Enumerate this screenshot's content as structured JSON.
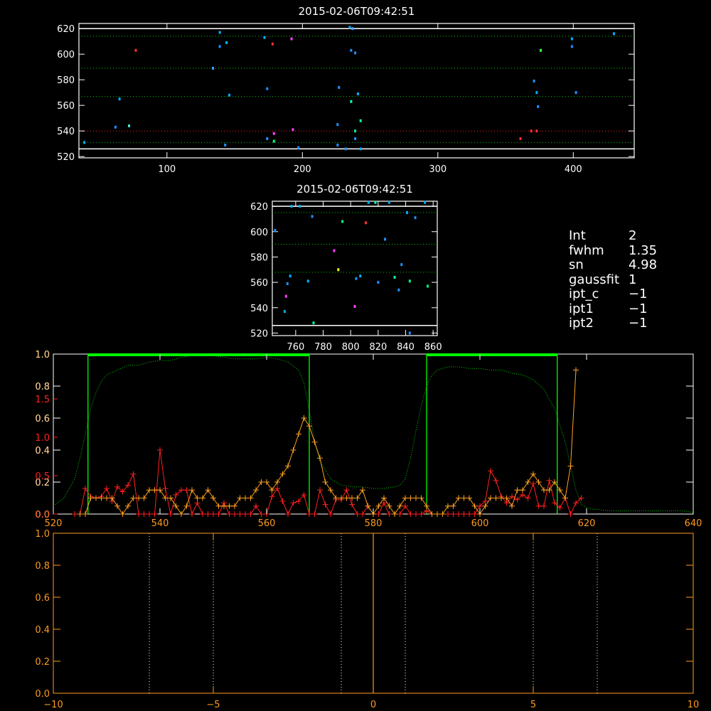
{
  "colors": {
    "background": "#000000",
    "axis": "#ffffff",
    "orange_axis": "#ff9a1e",
    "red": "#ff2020",
    "orange": "#ffa020",
    "green": "#00ff00",
    "cyan_dots": "#00b0ff"
  },
  "chart_data": [
    {
      "id": "top",
      "type": "scatter",
      "title": "2015-02-06T09:42:51",
      "xlim": [
        35,
        445
      ],
      "ylim": [
        519,
        624
      ],
      "xticks": [
        100,
        200,
        300,
        400
      ],
      "yticks": [
        520,
        540,
        560,
        580,
        600,
        620
      ],
      "hlines": [
        {
          "y": 620,
          "color": "#ffffff",
          "style": "solid"
        },
        {
          "y": 614,
          "color": "#00cc00",
          "style": "dotted"
        },
        {
          "y": 589,
          "color": "#00cc00",
          "style": "dotted"
        },
        {
          "y": 567,
          "color": "#00cc00",
          "style": "dotted"
        },
        {
          "y": 540,
          "color": "#ff2020",
          "style": "dotted"
        },
        {
          "y": 531,
          "color": "#00cc00",
          "style": "dotted"
        },
        {
          "y": 526,
          "color": "#ffffff",
          "style": "solid"
        }
      ],
      "points": [
        [
          39,
          531,
          "#00b0ff"
        ],
        [
          62,
          543,
          "#1e90ff"
        ],
        [
          65,
          565,
          "#00b0ff"
        ],
        [
          72,
          544,
          "#40e0d0"
        ],
        [
          77,
          603,
          "#ff3030"
        ],
        [
          134,
          589,
          "#40a0ff"
        ],
        [
          139,
          617,
          "#00b0ff"
        ],
        [
          139,
          606,
          "#1e90ff"
        ],
        [
          143,
          529,
          "#1e90ff"
        ],
        [
          144,
          609,
          "#00b0ff"
        ],
        [
          146,
          568,
          "#00b0ff"
        ],
        [
          172,
          613,
          "#00b0ff"
        ],
        [
          174,
          534,
          "#1e90ff"
        ],
        [
          174,
          573,
          "#1e90ff"
        ],
        [
          178,
          608,
          "#ff3030"
        ],
        [
          179,
          538,
          "#ff40ff"
        ],
        [
          179,
          532,
          "#00ff80"
        ],
        [
          192,
          612,
          "#ff40ff"
        ],
        [
          193,
          541,
          "#ff40ff"
        ],
        [
          197,
          527,
          "#1e90ff"
        ],
        [
          226,
          545,
          "#1e90ff"
        ],
        [
          226,
          529,
          "#1e90ff"
        ],
        [
          227,
          574,
          "#1e90ff"
        ],
        [
          232,
          526,
          "#1e90ff"
        ],
        [
          235,
          621,
          "#00b0ff"
        ],
        [
          237,
          620,
          "#40a0ff"
        ],
        [
          236,
          603,
          "#1e90ff"
        ],
        [
          236,
          563,
          "#00ffb0"
        ],
        [
          239,
          601,
          "#1e90ff"
        ],
        [
          239,
          540,
          "#00ffb0"
        ],
        [
          239,
          534,
          "#1e90ff"
        ],
        [
          241,
          569,
          "#00b0ff"
        ],
        [
          243,
          548,
          "#00ffb0"
        ],
        [
          243,
          526,
          "#00b0ff"
        ],
        [
          361,
          534,
          "#ff3030"
        ],
        [
          369,
          540,
          "#ff3030"
        ],
        [
          371,
          579,
          "#1e90ff"
        ],
        [
          373,
          540,
          "#ff3030"
        ],
        [
          373,
          570,
          "#00b0ff"
        ],
        [
          374,
          559,
          "#1e90ff"
        ],
        [
          376,
          603,
          "#40ff40"
        ],
        [
          399,
          606,
          "#1e90ff"
        ],
        [
          399,
          612,
          "#00b0ff"
        ],
        [
          402,
          570,
          "#1e90ff"
        ],
        [
          430,
          616,
          "#00b0ff"
        ]
      ]
    },
    {
      "id": "middle",
      "type": "scatter",
      "title": "2015-02-06T09:42:51",
      "xlim": [
        743,
        863
      ],
      "ylim": [
        518,
        624
      ],
      "xticks": [
        760,
        780,
        800,
        820,
        840,
        860
      ],
      "yticks": [
        520,
        540,
        560,
        580,
        600,
        620
      ],
      "hlines": [
        {
          "y": 620,
          "color": "#ffffff",
          "style": "solid"
        },
        {
          "y": 615,
          "color": "#00cc00",
          "style": "dotted"
        },
        {
          "y": 590,
          "color": "#00cc00",
          "style": "dotted"
        },
        {
          "y": 568,
          "color": "#00cc00",
          "style": "dotted"
        },
        {
          "y": 526,
          "color": "#ffffff",
          "style": "solid"
        }
      ],
      "points": [
        [
          745,
          601,
          "#1e90ff"
        ],
        [
          752,
          537,
          "#00b0ff"
        ],
        [
          753,
          549,
          "#ff40ff"
        ],
        [
          754,
          559,
          "#1e90ff"
        ],
        [
          756,
          565,
          "#00b0ff"
        ],
        [
          757,
          620,
          "#00b0ff"
        ],
        [
          763,
          620,
          "#00b0ff"
        ],
        [
          769,
          561,
          "#00b0ff"
        ],
        [
          772,
          612,
          "#1e90ff"
        ],
        [
          773,
          528,
          "#00ffb0"
        ],
        [
          788,
          585,
          "#ff40ff"
        ],
        [
          791,
          570,
          "#ffff00"
        ],
        [
          794,
          608,
          "#00ff80"
        ],
        [
          803,
          541,
          "#ff40ff"
        ],
        [
          804,
          563,
          "#1e90ff"
        ],
        [
          807,
          565,
          "#00b0ff"
        ],
        [
          811,
          607,
          "#ff3030"
        ],
        [
          813,
          623,
          "#00b0ff"
        ],
        [
          818,
          623,
          "#00ffb0"
        ],
        [
          820,
          560,
          "#1e90ff"
        ],
        [
          825,
          594,
          "#1e90ff"
        ],
        [
          828,
          623,
          "#00b0ff"
        ],
        [
          832,
          564,
          "#00ffb0"
        ],
        [
          835,
          554,
          "#1e90ff"
        ],
        [
          837,
          574,
          "#1e90ff"
        ],
        [
          841,
          615,
          "#00b0ff"
        ],
        [
          843,
          561,
          "#00ff80"
        ],
        [
          843,
          520,
          "#1e90ff"
        ],
        [
          847,
          611,
          "#1e90ff"
        ],
        [
          854,
          623,
          "#00b0ff"
        ],
        [
          856,
          557,
          "#00ff80"
        ]
      ]
    },
    {
      "id": "spectrum",
      "type": "line",
      "xlim": [
        520,
        640
      ],
      "ylim": [
        0,
        1.0
      ],
      "xticks": [
        520,
        540,
        560,
        580,
        600,
        620,
        640
      ],
      "yticks_white": [
        "0.0",
        "0.2",
        "0.4",
        "0.6",
        "0.8",
        "1.0"
      ],
      "yticks_red": [
        "0.0",
        "0.5",
        "1.0",
        "1.5"
      ],
      "yticks_red_values": [
        0,
        0.24,
        0.48,
        0.72
      ],
      "yticks_orange": [
        "0.0",
        "0.2",
        "0.4",
        "0.6",
        "0.8",
        "1.0"
      ],
      "green_boxes": [
        [
          526.5,
          568
        ],
        [
          590,
          614.5
        ]
      ],
      "series": [
        {
          "color": "#00cc00",
          "style": "dotted",
          "x": [
            520,
            522,
            524,
            525,
            526,
            527,
            528,
            529,
            530,
            532,
            534,
            536,
            538,
            540,
            542,
            544,
            546,
            548,
            550,
            552,
            554,
            556,
            558,
            560,
            562,
            564,
            566,
            567,
            568,
            569,
            570,
            572,
            574,
            576,
            578,
            580,
            582,
            584,
            585,
            586,
            587,
            588,
            589,
            590,
            591,
            592,
            594,
            596,
            598,
            600,
            602,
            604,
            606,
            608,
            610,
            612,
            614,
            616,
            617,
            618,
            619,
            620,
            621,
            622,
            624,
            626,
            628,
            630,
            632,
            634,
            636,
            638,
            640
          ],
          "y": [
            0.05,
            0.1,
            0.22,
            0.35,
            0.5,
            0.66,
            0.76,
            0.83,
            0.87,
            0.9,
            0.93,
            0.93,
            0.95,
            0.96,
            0.96,
            0.98,
            0.99,
            1.0,
            0.99,
            0.98,
            0.97,
            0.97,
            0.97,
            0.98,
            0.97,
            0.95,
            0.9,
            0.82,
            0.65,
            0.45,
            0.33,
            0.22,
            0.18,
            0.17,
            0.17,
            0.16,
            0.16,
            0.17,
            0.18,
            0.22,
            0.35,
            0.52,
            0.68,
            0.8,
            0.87,
            0.9,
            0.92,
            0.92,
            0.91,
            0.91,
            0.9,
            0.9,
            0.88,
            0.87,
            0.84,
            0.78,
            0.66,
            0.45,
            0.3,
            0.15,
            0.06,
            0.04,
            0.03,
            0.03,
            0.02,
            0.02,
            0.02,
            0.02,
            0.02,
            0.02,
            0.02,
            0.02,
            0.01
          ]
        },
        {
          "color": "#ff2020",
          "style": "solid",
          "marker": "plus",
          "x": [
            524,
            525,
            526,
            527,
            528,
            529,
            530,
            531,
            532,
            533,
            534,
            535,
            536,
            537,
            538,
            539,
            540,
            541,
            542,
            543,
            544,
            545,
            546,
            547,
            548,
            549,
            550,
            551,
            552,
            553,
            554,
            555,
            556,
            557,
            558,
            559,
            560,
            561,
            562,
            563,
            564,
            565,
            566,
            567,
            568,
            569,
            570,
            571,
            572,
            573,
            574,
            575,
            576,
            577,
            578,
            579,
            580,
            581,
            582,
            583,
            584,
            585,
            586,
            587,
            588,
            589,
            590,
            591,
            592,
            593,
            594,
            595,
            596,
            597,
            598,
            599,
            600,
            601,
            602,
            603,
            604,
            605,
            606,
            607,
            608,
            609,
            610,
            611,
            612,
            613,
            614,
            615,
            616,
            617,
            618,
            619
          ],
          "y": [
            0,
            0,
            0.16,
            0.11,
            0.1,
            0.11,
            0.16,
            0.08,
            0.17,
            0.14,
            0.18,
            0.25,
            0,
            0,
            0,
            0,
            0.4,
            0.16,
            0,
            0.12,
            0.15,
            0.15,
            0,
            0.07,
            0,
            0,
            0,
            0,
            0.07,
            0,
            0,
            0,
            0,
            0,
            0.05,
            0,
            0,
            0.11,
            0.16,
            0.08,
            0,
            0.07,
            0.08,
            0.12,
            0,
            0,
            0.15,
            0.06,
            0,
            0.09,
            0.09,
            0.15,
            0.06,
            0,
            0,
            0.05,
            0,
            0,
            0.07,
            0,
            0,
            0,
            0.05,
            0,
            0,
            0,
            0.02,
            0,
            0,
            0,
            0,
            0,
            0,
            0,
            0,
            0,
            0.05,
            0.08,
            0.27,
            0.21,
            0.11,
            0.07,
            0.11,
            0.09,
            0.12,
            0.1,
            0.19,
            0.05,
            0.05,
            0.21,
            0.07,
            0.04,
            0.1,
            0,
            0.07,
            0.1
          ]
        },
        {
          "color": "#ffa020",
          "style": "solid",
          "marker": "plus",
          "x": [
            525,
            526,
            527,
            528,
            529,
            530,
            531,
            532,
            533,
            534,
            535,
            536,
            537,
            538,
            539,
            540,
            541,
            542,
            543,
            544,
            545,
            546,
            547,
            548,
            549,
            550,
            551,
            552,
            553,
            554,
            555,
            556,
            557,
            558,
            559,
            560,
            561,
            562,
            563,
            564,
            565,
            566,
            567,
            568,
            569,
            570,
            571,
            572,
            573,
            574,
            575,
            576,
            577,
            578,
            579,
            580,
            581,
            582,
            583,
            584,
            585,
            586,
            587,
            588,
            589,
            590,
            591,
            592,
            593,
            594,
            595,
            596,
            597,
            598,
            599,
            600,
            601,
            602,
            603,
            604,
            605,
            606,
            607,
            608,
            609,
            610,
            611,
            612,
            613,
            614,
            615,
            616,
            617,
            618
          ],
          "y": [
            0,
            0,
            0.1,
            0.1,
            0.1,
            0.1,
            0.1,
            0.05,
            0,
            0.05,
            0.1,
            0.1,
            0.1,
            0.15,
            0.15,
            0.15,
            0.1,
            0.1,
            0.05,
            0,
            0.05,
            0.15,
            0.1,
            0.1,
            0.15,
            0.1,
            0.05,
            0.05,
            0.05,
            0.05,
            0.1,
            0.1,
            0.1,
            0.15,
            0.2,
            0.2,
            0.15,
            0.2,
            0.25,
            0.3,
            0.4,
            0.5,
            0.6,
            0.55,
            0.45,
            0.35,
            0.2,
            0.15,
            0.1,
            0.1,
            0.1,
            0.1,
            0.1,
            0.15,
            0.05,
            0,
            0.05,
            0.1,
            0.05,
            0,
            0.05,
            0.1,
            0.1,
            0.1,
            0.1,
            0.05,
            0,
            0,
            0,
            0.05,
            0.05,
            0.1,
            0.1,
            0.1,
            0.05,
            0,
            0.05,
            0.1,
            0.1,
            0.1,
            0.1,
            0.05,
            0.15,
            0.15,
            0.2,
            0.25,
            0.2,
            0.15,
            0.15,
            0.2,
            0.15,
            0.1,
            0.3,
            0.9
          ]
        }
      ]
    },
    {
      "id": "bottom",
      "type": "line",
      "xlim": [
        -10,
        10
      ],
      "ylim": [
        0,
        1.0
      ],
      "xticks": [
        "-10",
        "-5",
        "0",
        "5",
        "10"
      ],
      "yticks": [
        "0.0",
        "0.2",
        "0.4",
        "0.6",
        "0.8",
        "1.0"
      ],
      "vlines_dotted": [
        -7,
        -5,
        -1,
        1,
        5,
        7
      ],
      "vline_solid": 0
    }
  ],
  "info_panel": [
    {
      "key": "Int",
      "value": "2"
    },
    {
      "key": "fwhm",
      "value": "1.35"
    },
    {
      "key": "sn",
      "value": "4.98"
    },
    {
      "key": "gaussfit",
      "value": "1"
    },
    {
      "key": "ipt_c",
      "value": "−1"
    },
    {
      "key": "ipt1",
      "value": "−1"
    },
    {
      "key": "ipt2",
      "value": "−1"
    }
  ]
}
